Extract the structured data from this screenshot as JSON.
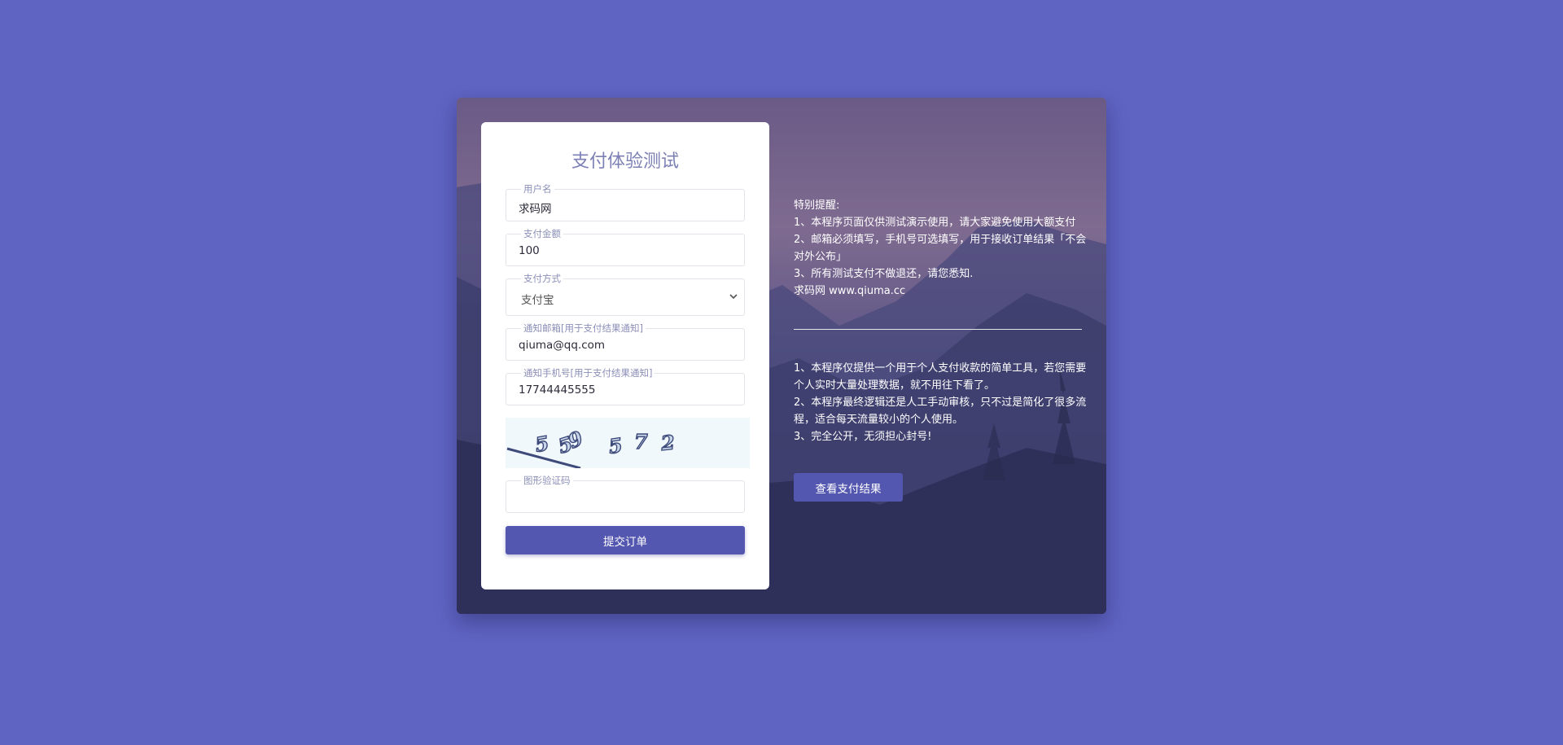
{
  "form": {
    "title": "支付体验测试",
    "username": {
      "label": "用户名",
      "value": "求码网"
    },
    "amount": {
      "label": "支付金额",
      "value": "100"
    },
    "payment_method": {
      "label": "支付方式",
      "value": "支付宝"
    },
    "email": {
      "label": "通知邮箱[用于支付结果通知]",
      "value": "qiuma@qq.com"
    },
    "phone": {
      "label": "通知手机号[用于支付结果通知]",
      "value": "17744445555"
    },
    "captcha": {
      "label": "图形验证码",
      "value": "",
      "image_text": "559572"
    },
    "submit_label": "提交订单"
  },
  "notice": {
    "heading": "特别提醒:",
    "lines": [
      "1、本程序页面仅供测试演示使用，请大家避免使用大额支付",
      "2、邮箱必须填写，手机号可选填写，用于接收订单结果「不会对外公布」",
      "3、所有测试支付不做退还，请您悉知.",
      "求码网 www.qiuma.cc"
    ]
  },
  "info": {
    "lines": [
      "1、本程序仅提供一个用于个人支付收款的简单工具，若您需要个人实时大量处理数据，就不用往下看了。",
      "2、本程序最终逻辑还是人工手动审核，只不过是简化了很多流程，适合每天流量较小的个人使用。",
      "3、完全公开，无须担心封号!"
    ]
  },
  "result_button_label": "查看支付结果",
  "colors": {
    "page_bg": "#5f63c2",
    "accent": "#5457b0",
    "title": "#7c80b4"
  }
}
